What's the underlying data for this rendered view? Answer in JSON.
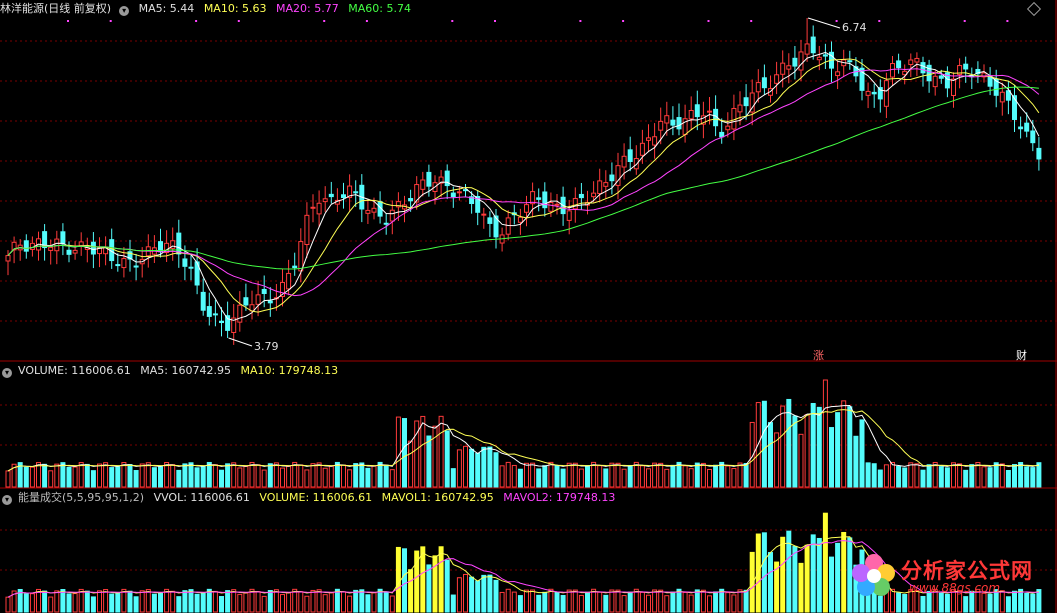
{
  "main_header": {
    "title": "林洋能源(日线 前复权)",
    "ma5": "MA5: 5.44",
    "ma10": "MA10: 5.63",
    "ma20": "MA20: 5.77",
    "ma60": "MA60: 5.74"
  },
  "volume_header": {
    "volume": "VOLUME: 116006.61",
    "ma5": "MA5: 160742.95",
    "ma10": "MA10: 179748.13"
  },
  "indicator_header": {
    "name": "能量成交(5,5,95,95,1,2)",
    "vvol": "VVOL: 116006.61",
    "volume": "VOLUME: 116006.61",
    "mavol1": "MAVOL1: 160742.95",
    "mavol2": "MAVOL2: 179748.13"
  },
  "markers": {
    "high_label": "6.74",
    "low_label": "3.79",
    "event_zhang": "涨",
    "event_cai": "财"
  },
  "watermark": {
    "text": "分析家公式网",
    "url": "www.88gs.com"
  },
  "colors": {
    "up": "#ff3b3b",
    "down": "#54fcfc",
    "ma5": "#ffffff",
    "ma10": "#ffff55",
    "ma20": "#ff44ff",
    "ma60": "#44ff44",
    "grid": "#7a0000"
  },
  "chart_data": {
    "type": "candlestick",
    "price_high": 6.74,
    "price_low": 3.79,
    "ma_values": {
      "MA5": 5.44,
      "MA10": 5.63,
      "MA20": 5.77,
      "MA60": 5.74
    },
    "close_path": [
      4.55,
      4.62,
      4.58,
      4.66,
      4.7,
      4.68,
      4.62,
      4.6,
      4.55,
      4.52,
      4.5,
      4.55,
      4.58,
      4.62,
      4.6,
      4.55,
      4.4,
      4.15,
      4.0,
      3.9,
      3.95,
      4.1,
      4.15,
      4.2,
      4.3,
      4.5,
      4.8,
      5.05,
      5.0,
      5.15,
      5.2,
      5.05,
      4.9,
      4.85,
      4.95,
      5.1,
      5.25,
      5.3,
      5.2,
      5.1,
      5.05,
      5.0,
      4.85,
      4.8,
      4.9,
      4.95,
      5.05,
      5.02,
      5.0,
      5.05,
      5.08,
      5.1,
      5.15,
      5.3,
      5.45,
      5.55,
      5.65,
      5.8,
      5.7,
      5.75,
      5.85,
      5.95,
      5.7,
      5.8,
      5.9,
      6.0,
      6.1,
      6.2,
      6.4,
      6.35,
      6.5,
      6.3,
      6.25,
      6.35,
      6.3,
      6.05,
      6.0,
      6.2,
      6.25,
      6.35,
      6.3,
      6.2,
      6.15,
      6.2,
      6.22,
      6.18,
      6.15,
      6.05,
      5.85,
      5.6,
      5.45
    ],
    "volume": 116006.61,
    "volume_ma5": 160742.95,
    "volume_ma10": 179748.13
  }
}
